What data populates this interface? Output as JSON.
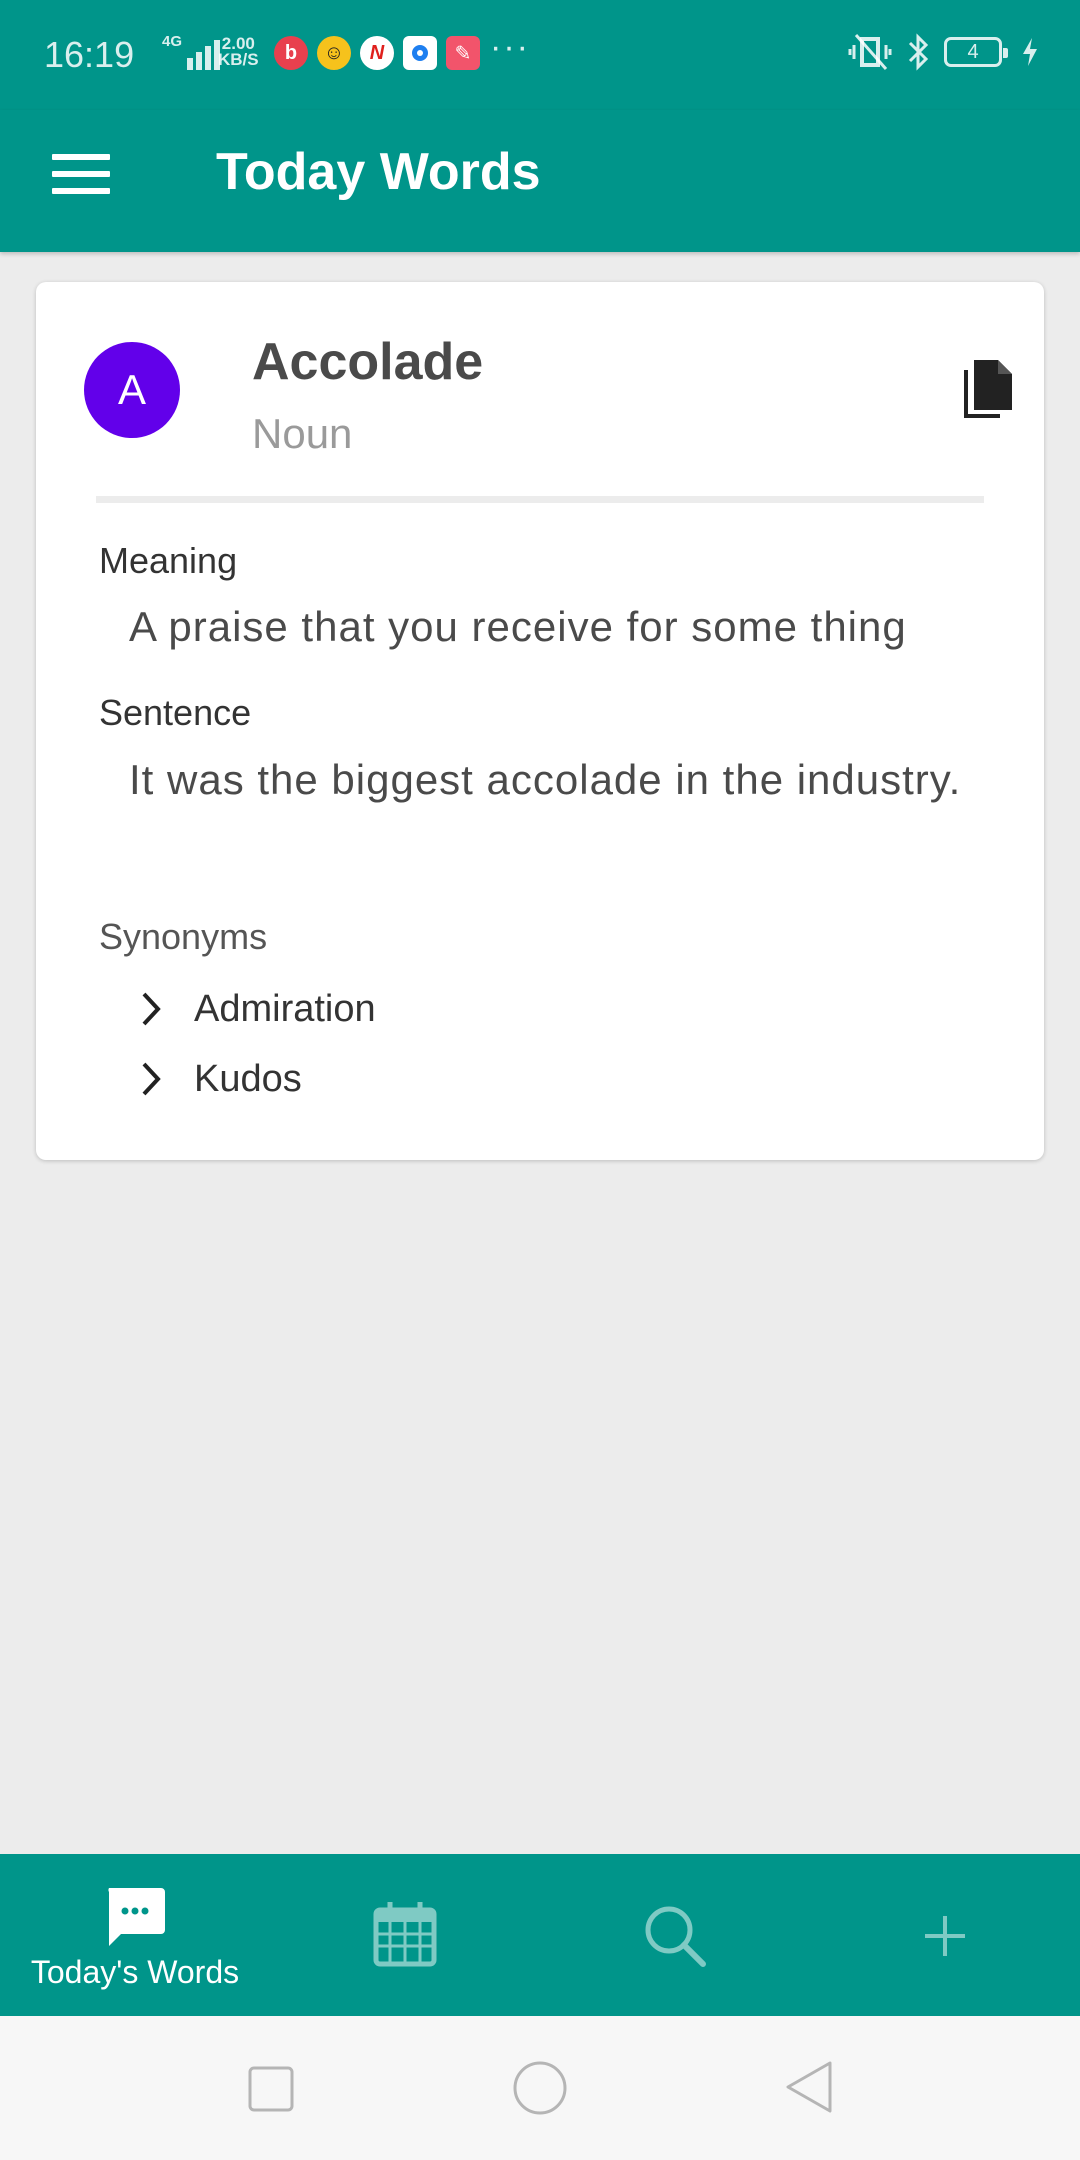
{
  "status_bar": {
    "time": "16:19",
    "network": "4G",
    "speed_value": "2.00",
    "speed_unit": "KB/S",
    "more": "···",
    "battery": "4",
    "notif_icons": [
      "bilibili-icon",
      "emoji-app-icon",
      "n-app-icon",
      "blue-app-icon",
      "pink-app-icon"
    ]
  },
  "app_bar": {
    "title": "Today Words"
  },
  "word_card": {
    "avatar_letter": "A",
    "avatar_color": "#6200ea",
    "word": "Accolade",
    "part_of_speech": "Noun",
    "meaning_label": "Meaning",
    "meaning": "A praise that you receive for some thing",
    "sentence_label": "Sentence",
    "sentence": "It was the biggest accolade in the industry.",
    "synonyms_label": "Synonyms",
    "synonyms": [
      "Admiration",
      "Kudos"
    ]
  },
  "bottom_nav": {
    "items": [
      {
        "label": "Today's Words",
        "icon": "chat-bubble-icon",
        "active": true
      },
      {
        "label": "",
        "icon": "calendar-icon",
        "active": false
      },
      {
        "label": "",
        "icon": "search-icon",
        "active": false
      },
      {
        "label": "",
        "icon": "add-icon",
        "active": false
      }
    ]
  },
  "colors": {
    "primary": "#00958a",
    "background": "#ececec",
    "card": "#ffffff"
  }
}
